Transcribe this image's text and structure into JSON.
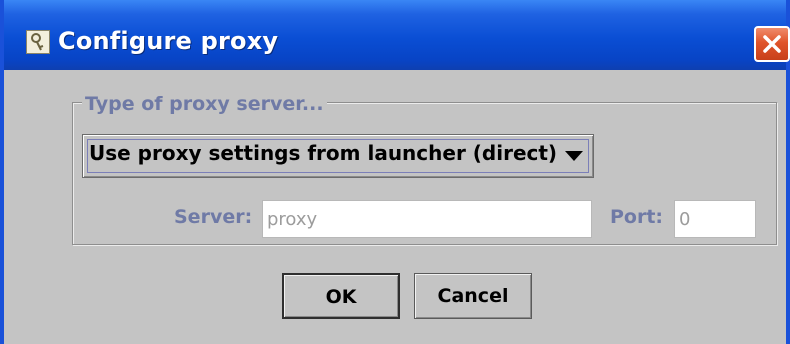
{
  "window": {
    "title": "Configure proxy"
  },
  "icons": {
    "app": "key-icon",
    "close": "close-icon",
    "dropdown": "chevron-down-icon"
  },
  "proxy_group": {
    "legend": "Type of proxy server...",
    "type_select": {
      "selected": "Use proxy settings from launcher (direct)"
    },
    "server": {
      "label": "Server:",
      "value": "proxy"
    },
    "port": {
      "label": "Port:",
      "value": "0"
    }
  },
  "buttons": {
    "ok": "OK",
    "cancel": "Cancel"
  },
  "colors": {
    "titlebar": "#0a4ed4",
    "close_button": "#e0542a",
    "disabled_label": "#6f7aa6",
    "dialog_background": "#c4c4c4"
  }
}
